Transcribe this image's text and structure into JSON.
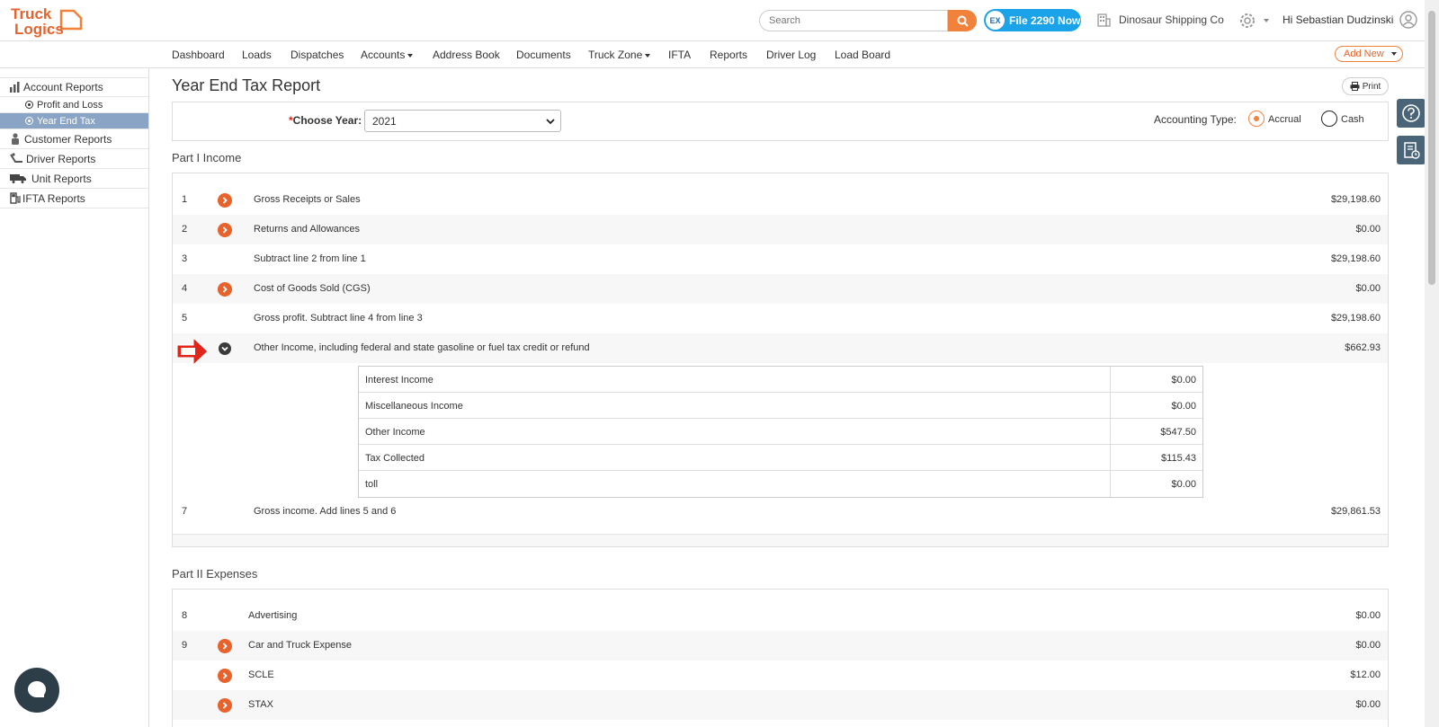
{
  "header": {
    "logo_line1": "Truck",
    "logo_line2": "Logics",
    "search_placeholder": "Search",
    "file_button": "File 2290 Now",
    "file_button_badge": "EX",
    "company": "Dinosaur Shipping Co",
    "greeting": "Hi Sebastian Dudzinski"
  },
  "nav": {
    "items": [
      "Dashboard",
      "Loads",
      "Dispatches",
      "Accounts",
      "Address Book",
      "Documents",
      "Truck Zone",
      "IFTA",
      "Reports",
      "Driver Log",
      "Load Board"
    ],
    "add_new": "Add New"
  },
  "sidebar": {
    "items": [
      "Account Reports",
      "Profit and Loss",
      "Year End Tax",
      "Customer Reports",
      "Driver Reports",
      "Unit Reports",
      "IFTA Reports"
    ]
  },
  "page": {
    "title": "Year End Tax Report",
    "print": "Print"
  },
  "filters": {
    "required_mark": "*",
    "choose_year_label": "Choose Year:",
    "year_value": "2021",
    "accounting_label": "Accounting Type:",
    "accrual": "Accrual",
    "cash": "Cash",
    "selected": "Accrual"
  },
  "part1": {
    "title": "Part I Income",
    "rows": [
      {
        "num": "1",
        "label": "Gross Receipts or Sales",
        "amount": "$29,198.60"
      },
      {
        "num": "2",
        "label": "Returns and Allowances",
        "amount": "$0.00"
      },
      {
        "num": "3",
        "label": "Subtract line 2 from line 1",
        "amount": "$29,198.60"
      },
      {
        "num": "4",
        "label": "Cost of Goods Sold (CGS)",
        "amount": "$0.00"
      },
      {
        "num": "5",
        "label": "Gross profit. Subtract line 4 from line 3",
        "amount": "$29,198.60"
      },
      {
        "num": "",
        "label": "Other Income, including federal and state gasoline or fuel tax credit or refund",
        "amount": "$662.93"
      },
      {
        "num": "7",
        "label": "Gross income. Add lines 5 and 6",
        "amount": "$29,861.53"
      }
    ],
    "other_income_breakdown": [
      {
        "label": "Interest Income",
        "amount": "$0.00"
      },
      {
        "label": "Miscellaneous Income",
        "amount": "$0.00"
      },
      {
        "label": "Other Income",
        "amount": "$547.50"
      },
      {
        "label": "Tax Collected",
        "amount": "$115.43"
      },
      {
        "label": "toll",
        "amount": "$0.00"
      }
    ]
  },
  "part2": {
    "title": "Part II Expenses",
    "rows": [
      {
        "num": "8",
        "label": "Advertising",
        "amount": "$0.00"
      },
      {
        "num": "9",
        "label": "Car and Truck Expense",
        "amount": "$0.00"
      },
      {
        "num": "",
        "label": "SCLE",
        "amount": "$12.00"
      },
      {
        "num": "",
        "label": "STAX",
        "amount": "$0.00"
      }
    ]
  },
  "colors": {
    "brand_orange": "#f0823c",
    "file_blue": "#1aa3e8",
    "sidebar_active": "#8aa4c6"
  }
}
